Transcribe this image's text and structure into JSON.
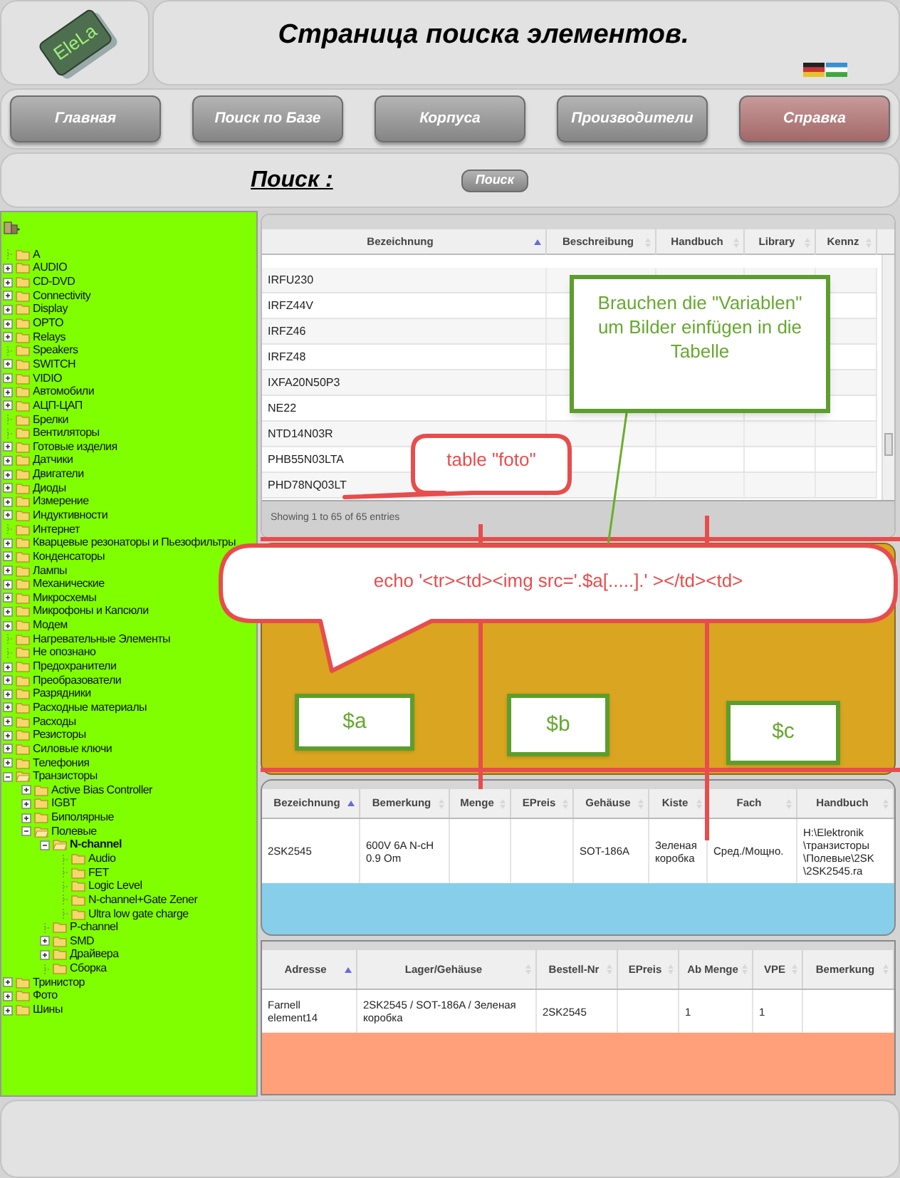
{
  "logo": {
    "text": "EleLa"
  },
  "header": {
    "title": "Страница поиска элементов."
  },
  "nav": [
    {
      "label": "Главная",
      "selected": false
    },
    {
      "label": "Поиск по Базе",
      "selected": false
    },
    {
      "label": "Корпуса",
      "selected": false
    },
    {
      "label": "Производители",
      "selected": false
    },
    {
      "label": "Справка",
      "selected": true
    }
  ],
  "search": {
    "label": "Поиск :",
    "button": "Поиск"
  },
  "tree": {
    "items": [
      {
        "label": "A",
        "kind": "leaf",
        "expanded": false,
        "selected": false
      },
      {
        "label": "AUDIO",
        "kind": "branch",
        "expanded": false,
        "selected": false
      },
      {
        "label": "CD-DVD",
        "kind": "branch",
        "expanded": false,
        "selected": false
      },
      {
        "label": "Connectivity",
        "kind": "branch",
        "expanded": false,
        "selected": false
      },
      {
        "label": "Display",
        "kind": "branch",
        "expanded": false,
        "selected": false
      },
      {
        "label": "OPTO",
        "kind": "branch",
        "expanded": false,
        "selected": false
      },
      {
        "label": "Relays",
        "kind": "branch",
        "expanded": false,
        "selected": false
      },
      {
        "label": "Speakers",
        "kind": "leaf",
        "expanded": false,
        "selected": false
      },
      {
        "label": "SWITCH",
        "kind": "branch",
        "expanded": false,
        "selected": false
      },
      {
        "label": "VIDIO",
        "kind": "branch",
        "expanded": false,
        "selected": false
      },
      {
        "label": "Автомобили",
        "kind": "branch",
        "expanded": false,
        "selected": false
      },
      {
        "label": "АЦП-ЦАП",
        "kind": "branch",
        "expanded": false,
        "selected": false
      },
      {
        "label": "Брелки",
        "kind": "leaf",
        "expanded": false,
        "selected": false
      },
      {
        "label": "Вентиляторы",
        "kind": "leaf",
        "expanded": false,
        "selected": false
      },
      {
        "label": "Готовые изделия",
        "kind": "branch",
        "expanded": false,
        "selected": false
      },
      {
        "label": "Датчики",
        "kind": "branch",
        "expanded": false,
        "selected": false
      },
      {
        "label": "Двигатели",
        "kind": "branch",
        "expanded": false,
        "selected": false
      },
      {
        "label": "Диоды",
        "kind": "branch",
        "expanded": false,
        "selected": false
      },
      {
        "label": "Измерение",
        "kind": "branch",
        "expanded": false,
        "selected": false
      },
      {
        "label": "Индуктивности",
        "kind": "branch",
        "expanded": false,
        "selected": false
      },
      {
        "label": "Интернет",
        "kind": "leaf",
        "expanded": false,
        "selected": false
      },
      {
        "label": "Кварцевые резонаторы и Пьезофильтры",
        "kind": "branch",
        "expanded": false,
        "selected": false
      },
      {
        "label": "Конденсаторы",
        "kind": "branch",
        "expanded": false,
        "selected": false
      },
      {
        "label": "Лампы",
        "kind": "branch",
        "expanded": false,
        "selected": false
      },
      {
        "label": "Механические",
        "kind": "branch",
        "expanded": false,
        "selected": false
      },
      {
        "label": "Микросхемы",
        "kind": "branch",
        "expanded": false,
        "selected": false
      },
      {
        "label": "Микрофоны и Капсюли",
        "kind": "branch",
        "expanded": false,
        "selected": false
      },
      {
        "label": "Модем",
        "kind": "branch",
        "expanded": false,
        "selected": false
      },
      {
        "label": "Нагревательные Элементы",
        "kind": "leaf",
        "expanded": false,
        "selected": false
      },
      {
        "label": "Не опознано",
        "kind": "leaf",
        "expanded": false,
        "selected": false
      },
      {
        "label": "Предохранители",
        "kind": "branch",
        "expanded": false,
        "selected": false
      },
      {
        "label": "Преобразователи",
        "kind": "branch",
        "expanded": false,
        "selected": false
      },
      {
        "label": "Разрядники",
        "kind": "branch",
        "expanded": false,
        "selected": false
      },
      {
        "label": "Расходные материалы",
        "kind": "branch",
        "expanded": false,
        "selected": false
      },
      {
        "label": "Расходы",
        "kind": "branch",
        "expanded": false,
        "selected": false
      },
      {
        "label": "Резисторы",
        "kind": "branch",
        "expanded": false,
        "selected": false
      },
      {
        "label": "Силовые ключи",
        "kind": "branch",
        "expanded": false,
        "selected": false
      },
      {
        "label": "Телефония",
        "kind": "branch",
        "expanded": false,
        "selected": false
      },
      {
        "label": "Транзисторы",
        "kind": "branch",
        "expanded": true,
        "selected": false,
        "children": [
          {
            "label": "Active Bias Controller",
            "kind": "branch",
            "expanded": false,
            "selected": false
          },
          {
            "label": "IGBT",
            "kind": "branch",
            "expanded": false,
            "selected": false
          },
          {
            "label": "Биполярные",
            "kind": "branch",
            "expanded": false,
            "selected": false
          },
          {
            "label": "Полевые",
            "kind": "branch",
            "expanded": true,
            "selected": false,
            "children": [
              {
                "label": "N-channel",
                "kind": "branch",
                "expanded": true,
                "selected": true,
                "children": [
                  {
                    "label": "Audio",
                    "kind": "leaf",
                    "expanded": false,
                    "selected": false
                  },
                  {
                    "label": "FET",
                    "kind": "leaf",
                    "expanded": false,
                    "selected": false
                  },
                  {
                    "label": "Logic Level",
                    "kind": "leaf",
                    "expanded": false,
                    "selected": false
                  },
                  {
                    "label": "N-channel+Gate Zener",
                    "kind": "leaf",
                    "expanded": false,
                    "selected": false
                  },
                  {
                    "label": "Ultra low gate charge",
                    "kind": "leaf",
                    "expanded": false,
                    "selected": false
                  }
                ]
              },
              {
                "label": "P-channel",
                "kind": "leaf",
                "expanded": false,
                "selected": false
              },
              {
                "label": "SMD",
                "kind": "branch",
                "expanded": false,
                "selected": false
              },
              {
                "label": "Драйвера",
                "kind": "branch",
                "expanded": false,
                "selected": false
              },
              {
                "label": "Сборка",
                "kind": "leaf",
                "expanded": false,
                "selected": false
              }
            ]
          }
        ]
      },
      {
        "label": "Тринистор",
        "kind": "branch",
        "expanded": false,
        "selected": false
      },
      {
        "label": "Фото",
        "kind": "branch",
        "expanded": false,
        "selected": false
      },
      {
        "label": "Шины",
        "kind": "branch",
        "expanded": false,
        "selected": false
      }
    ]
  },
  "results_table": {
    "columns": [
      {
        "label": "Bezeichnung",
        "sorted": true
      },
      {
        "label": "Beschreibung",
        "sorted": false
      },
      {
        "label": "Handbuch",
        "sorted": false
      },
      {
        "label": "Library",
        "sorted": false
      },
      {
        "label": "Kennz",
        "sorted": false
      }
    ],
    "rows": [
      [
        "IRFU230"
      ],
      [
        "IRFZ44V"
      ],
      [
        "IRFZ46"
      ],
      [
        "IRFZ48"
      ],
      [
        "IXFA20N50P3"
      ],
      [
        "NE22"
      ],
      [
        "NTD14N03R"
      ],
      [
        "PHB55N03LTA"
      ],
      [
        "PHD78NQ03LT"
      ]
    ],
    "footer": "Showing 1 to 65 of 65 entries"
  },
  "detail_table": {
    "columns": [
      {
        "label": "Bezeichnung",
        "sorted": true
      },
      {
        "label": "Bemerkung",
        "sorted": false
      },
      {
        "label": "Menge",
        "sorted": false
      },
      {
        "label": "EPreis",
        "sorted": false
      },
      {
        "label": "Gehäuse",
        "sorted": false
      },
      {
        "label": "Kiste",
        "sorted": false
      },
      {
        "label": "Fach",
        "sorted": false
      },
      {
        "label": "Handbuch",
        "sorted": false
      }
    ],
    "rows": [
      [
        "2SK2545",
        "600V 6A N-cH 0.9 Om",
        "",
        "",
        "SOT-186A",
        "Зеленая коробка",
        "Сред./Мощно.",
        "H:\\Elektronik\\транзисторы\\Полевые\\2SK\\2SK2545.ra"
      ]
    ]
  },
  "supplier_table": {
    "columns": [
      {
        "label": "Adresse",
        "sorted": true
      },
      {
        "label": "Lager/Gehäuse",
        "sorted": false
      },
      {
        "label": "Bestell-Nr",
        "sorted": false
      },
      {
        "label": "EPreis",
        "sorted": false
      },
      {
        "label": "Ab Menge",
        "sorted": false
      },
      {
        "label": "VPE",
        "sorted": false
      },
      {
        "label": "Bemerkung",
        "sorted": false
      }
    ],
    "rows": [
      [
        "Farnell element14",
        "2SK2545 / SOT-186A / Зеленая коробка",
        "2SK2545",
        "",
        "1",
        "1",
        ""
      ]
    ]
  },
  "annotations": [
    {
      "kind": "note",
      "text": "Brauchen die \"Variablen\" um Bilder einfügen in die Tabelle"
    },
    {
      "kind": "callout",
      "text": "table \"foto\""
    },
    {
      "kind": "callout",
      "text": "echo '<tr><td><img src='.$a[.....].' ></td><td>"
    },
    {
      "kind": "tag",
      "text": "$a"
    },
    {
      "kind": "tag",
      "text": "$b"
    },
    {
      "kind": "tag",
      "text": "$c"
    }
  ]
}
